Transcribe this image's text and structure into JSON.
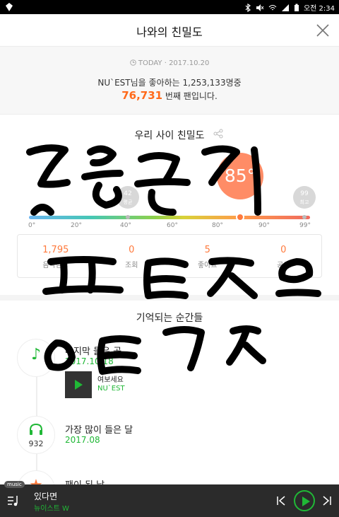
{
  "status_bar": {
    "time": "오전 2:34"
  },
  "header": {
    "title": "나와의 친밀도",
    "close_icon": "close-icon"
  },
  "today": {
    "label": "TODAY · 2017.10.20",
    "fans_text": "NU`EST님을 좋아하는 1,253,133명중",
    "rank_number": "76,731",
    "rank_suffix": " 번째 팬입니다."
  },
  "affinity": {
    "title": "우리 사이 친밀도",
    "score": "85°",
    "score_value": 85,
    "average": {
      "value": "42",
      "label": "평균"
    },
    "max": {
      "value": "99",
      "label": "최고"
    },
    "ticks": [
      "0°",
      "20°",
      "40°",
      "60°",
      "80°",
      "90°",
      "99°"
    ],
    "colors": {
      "accent": "#ff7a3d",
      "bubble": "#ff8c66",
      "green": "#20b836"
    }
  },
  "stats": [
    {
      "value": "1,795",
      "label": "음악감상"
    },
    {
      "value": "0",
      "label": "조회"
    },
    {
      "value": "5",
      "label": "좋아요"
    },
    {
      "value": "0",
      "label": "공유"
    }
  ],
  "moments": {
    "title": "기억되는 순간들",
    "last_played": {
      "title": "마지막 들은 곡",
      "date": "2017.10.18",
      "song": "여보세요",
      "artist": "NU`EST"
    },
    "most_month": {
      "count": "932",
      "title": "가장 많이 들은 달",
      "date": "2017.08"
    },
    "fan_day": {
      "title": "팬이 된 날"
    }
  },
  "player": {
    "tag": "music",
    "title": "있다면",
    "artist": "뉴이스트 W"
  }
}
